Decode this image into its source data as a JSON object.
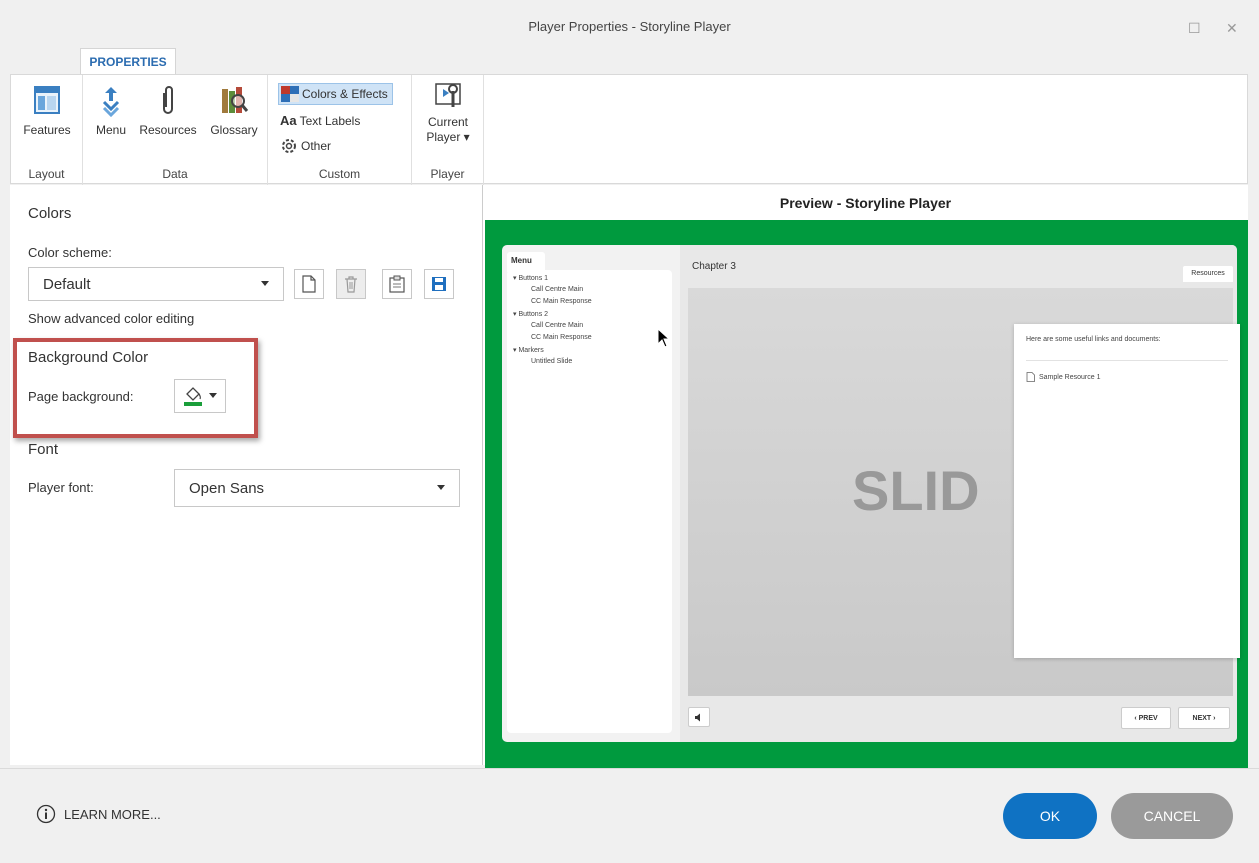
{
  "window": {
    "title": "Player Properties - Storyline Player",
    "maximize_glyph": "☐",
    "close_glyph": "✕"
  },
  "ribbon": {
    "tab_label": "PROPERTIES",
    "groups": {
      "layout": {
        "label": "Layout",
        "features": "Features"
      },
      "data": {
        "label": "Data",
        "menu": "Menu",
        "resources": "Resources",
        "glossary": "Glossary"
      },
      "custom": {
        "label": "Custom",
        "colors_effects": "Colors & Effects",
        "text_labels_prefix": "Aa",
        "text_labels": "Text Labels",
        "other": "Other"
      },
      "player": {
        "label": "Player",
        "current_player_line1": "Current",
        "current_player_line2": "Player ▾"
      }
    }
  },
  "left": {
    "colors_heading": "Colors",
    "color_scheme_label": "Color scheme:",
    "color_scheme_value": "Default",
    "advanced_link": "Show advanced color editing",
    "background_heading": "Background Color",
    "page_background_label": "Page background:",
    "page_background_color": "#1a9e3a",
    "font_heading": "Font",
    "player_font_label": "Player font:",
    "player_font_value": "Open Sans"
  },
  "preview": {
    "title": "Preview - Storyline Player",
    "stage_color": "#009a3e",
    "menu_tab": "Menu",
    "menu_items": [
      {
        "label": "▾ Buttons 1"
      },
      {
        "label": "Call Centre Main"
      },
      {
        "label": "CC Main Response"
      },
      {
        "label": "▾ Buttons 2"
      },
      {
        "label": "Call Centre Main"
      },
      {
        "label": "CC Main Response"
      },
      {
        "label": "▾ Markers"
      },
      {
        "label": "Untitled Slide"
      }
    ],
    "chapter_title": "Chapter 3",
    "resources_tab": "Resources",
    "resources_intro": "Here are some useful links and documents:",
    "resource_item": "Sample Resource 1",
    "slide_text": "SLID",
    "prev_label": "‹ PREV",
    "next_label": "NEXT ›"
  },
  "footer": {
    "learn_more": "LEARN MORE...",
    "ok": "OK",
    "cancel": "CANCEL",
    "ok_color": "#0f72c3",
    "cancel_color": "#9a9a9a"
  }
}
